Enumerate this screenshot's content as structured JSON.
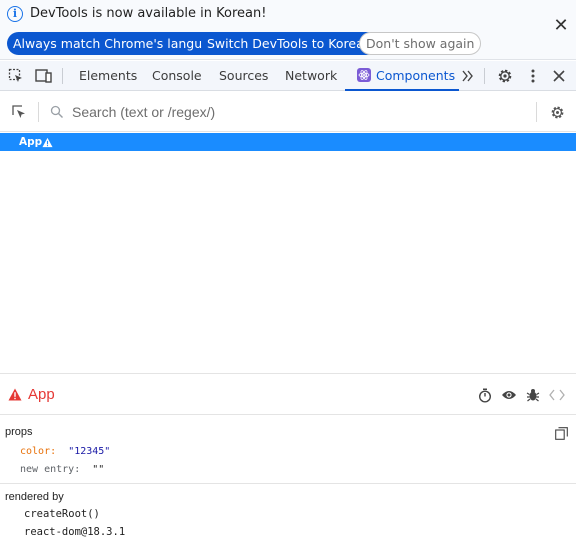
{
  "infobar": {
    "message": "DevTools is now available in Korean!",
    "buttons": {
      "match": "Always match Chrome's language",
      "switch": "Switch DevTools to Korean",
      "dismiss": "Don't show again"
    }
  },
  "tabs": {
    "items": [
      "Elements",
      "Console",
      "Sources",
      "Network",
      "Components"
    ],
    "active": "Components"
  },
  "search": {
    "placeholder": "Search (text or /regex/)"
  },
  "tree": {
    "selected_label": "App"
  },
  "inspected": {
    "name": "App"
  },
  "props": {
    "title": "props",
    "entries": [
      {
        "key": "color",
        "value": "\"12345\""
      },
      {
        "key": "new entry",
        "value": "\"\""
      }
    ]
  },
  "rendered_by": {
    "title": "rendered by",
    "items": [
      "createRoot()",
      "react-dom@18.3.1"
    ]
  },
  "colors": {
    "accent": "#0b57d0",
    "selection": "#1a8cff",
    "warning": "#e53935"
  }
}
